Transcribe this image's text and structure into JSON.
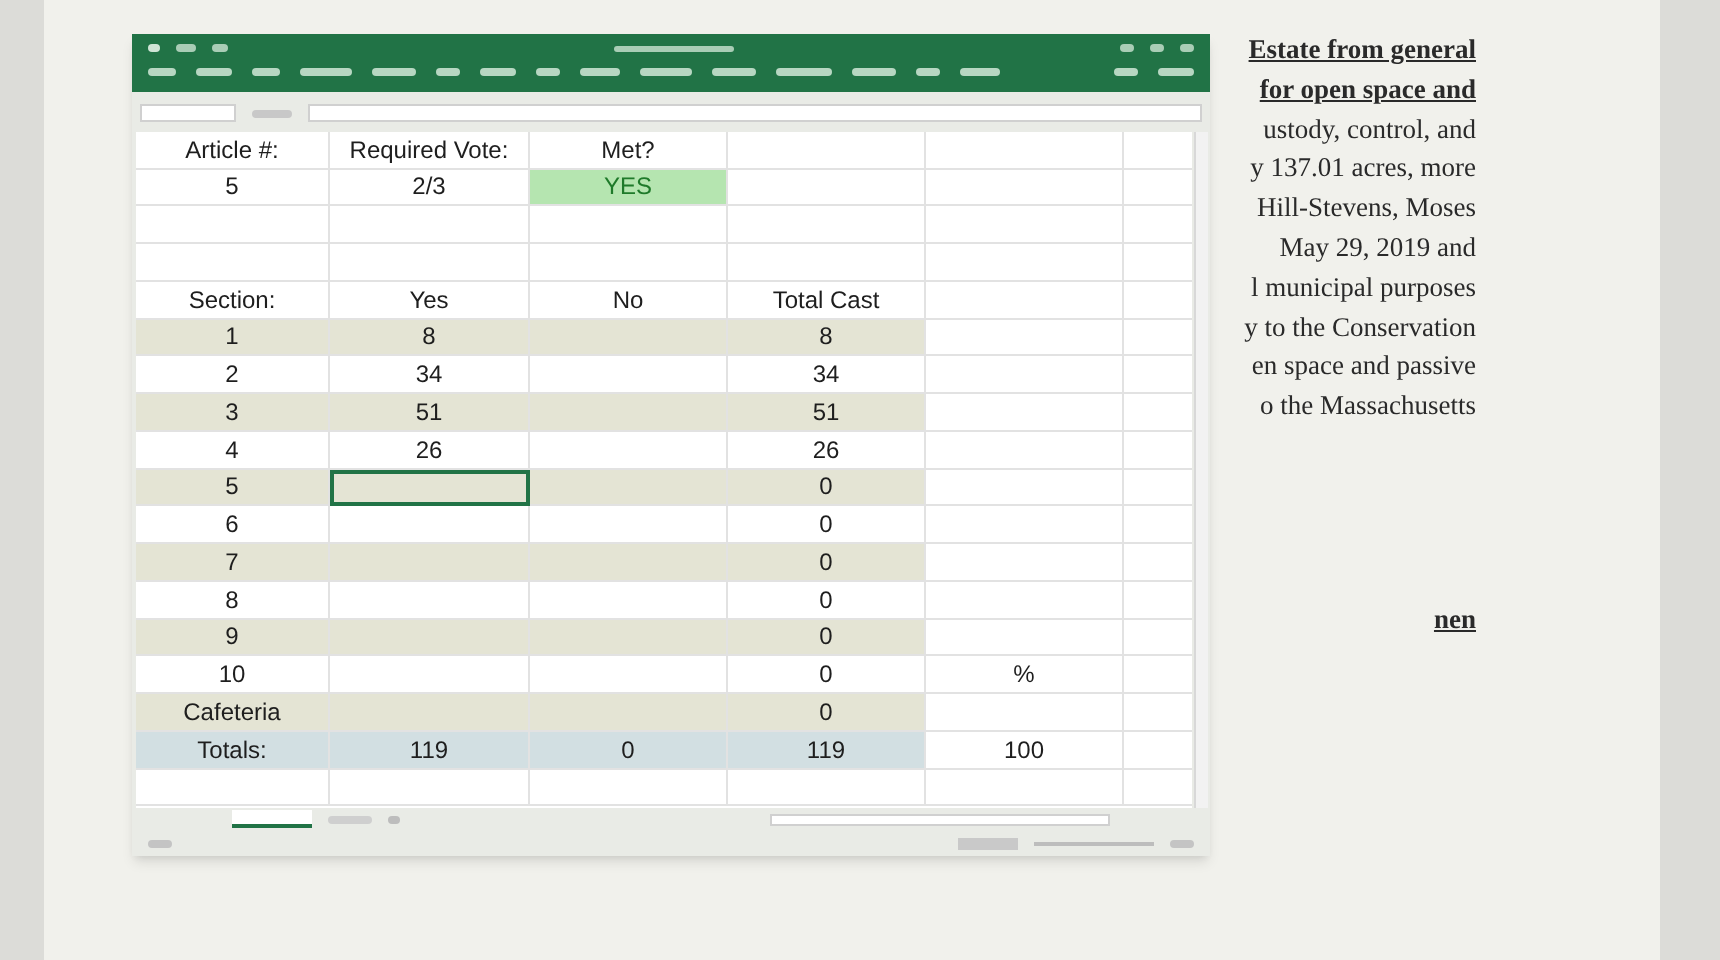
{
  "document": {
    "blocks": [
      {
        "bold": true,
        "lines": [
          "Estate from general",
          "for open space and"
        ]
      },
      {
        "bold": false,
        "lines": [
          "ustody, control, and",
          "y 137.01 acres, more",
          "Hill-Stevens, Moses",
          "May 29, 2019 and",
          "l municipal purposes",
          "y to the Conservation",
          "en space and passive",
          "o the Massachusetts"
        ]
      },
      {
        "bold": true,
        "lines": [
          "nen"
        ]
      }
    ]
  },
  "sheet": {
    "rows": [
      {
        "kind": "plain",
        "cells": [
          {
            "text": "Article #:",
            "selected": false
          },
          {
            "text": "Required Vote:",
            "selected": false
          },
          {
            "text": "Met?",
            "selected": false
          },
          {
            "selected": false
          },
          {
            "selected": false
          }
        ]
      },
      {
        "kind": "plain",
        "cells": [
          {
            "text": "5",
            "selected": false
          },
          {
            "text": "2/3",
            "selected": false
          },
          {
            "text": "YES",
            "highlight": true,
            "selected": false
          },
          {
            "selected": false
          },
          {
            "selected": false
          }
        ]
      },
      {
        "kind": "plain",
        "cells": [
          {
            "selected": false
          },
          {
            "selected": false
          },
          {
            "selected": false
          },
          {
            "selected": false
          },
          {
            "selected": false
          }
        ]
      },
      {
        "kind": "plain",
        "cells": [
          {
            "selected": false
          },
          {
            "selected": false
          },
          {
            "selected": false
          },
          {
            "selected": false
          },
          {
            "selected": false
          }
        ]
      },
      {
        "kind": "plain",
        "cells": [
          {
            "text": "Section:",
            "selected": false
          },
          {
            "text": "Yes",
            "selected": false
          },
          {
            "text": "No",
            "selected": false
          },
          {
            "text": "Total Cast",
            "selected": false
          },
          {
            "selected": false
          }
        ]
      },
      {
        "kind": "band",
        "cells": [
          {
            "text": "1",
            "selected": false
          },
          {
            "text": "8",
            "selected": false
          },
          {
            "selected": false
          },
          {
            "text": "8",
            "selected": false
          },
          {
            "selected": false
          }
        ]
      },
      {
        "kind": "plain",
        "cells": [
          {
            "text": "2",
            "selected": false
          },
          {
            "text": "34",
            "selected": false
          },
          {
            "selected": false
          },
          {
            "text": "34",
            "selected": false
          },
          {
            "selected": false
          }
        ]
      },
      {
        "kind": "band",
        "cells": [
          {
            "text": "3",
            "selected": false
          },
          {
            "text": "51",
            "selected": false
          },
          {
            "selected": false
          },
          {
            "text": "51",
            "selected": false
          },
          {
            "selected": false
          }
        ]
      },
      {
        "kind": "plain",
        "cells": [
          {
            "text": "4",
            "selected": false
          },
          {
            "text": "26",
            "selected": false
          },
          {
            "selected": false
          },
          {
            "text": "26",
            "selected": false
          },
          {
            "selected": false
          }
        ]
      },
      {
        "kind": "band",
        "cells": [
          {
            "text": "5",
            "selected": false
          },
          {
            "selected": true
          },
          {
            "selected": false
          },
          {
            "text": "0",
            "selected": false
          },
          {
            "selected": false
          }
        ]
      },
      {
        "kind": "plain",
        "cells": [
          {
            "text": "6",
            "selected": false
          },
          {
            "selected": false
          },
          {
            "selected": false
          },
          {
            "text": "0",
            "selected": false
          },
          {
            "selected": false
          }
        ]
      },
      {
        "kind": "band",
        "cells": [
          {
            "text": "7",
            "selected": false
          },
          {
            "selected": false
          },
          {
            "selected": false
          },
          {
            "text": "0",
            "selected": false
          },
          {
            "selected": false
          }
        ]
      },
      {
        "kind": "plain",
        "cells": [
          {
            "text": "8",
            "selected": false
          },
          {
            "selected": false
          },
          {
            "selected": false
          },
          {
            "text": "0",
            "selected": false
          },
          {
            "selected": false
          }
        ]
      },
      {
        "kind": "band",
        "cells": [
          {
            "text": "9",
            "selected": false
          },
          {
            "selected": false
          },
          {
            "selected": false
          },
          {
            "text": "0",
            "selected": false
          },
          {
            "selected": false
          }
        ]
      },
      {
        "kind": "plain",
        "cells": [
          {
            "text": "10",
            "selected": false
          },
          {
            "selected": false
          },
          {
            "selected": false
          },
          {
            "text": "0",
            "selected": false
          },
          {
            "text": "%",
            "selected": false
          }
        ]
      },
      {
        "kind": "band",
        "cells": [
          {
            "text": "Cafeteria",
            "selected": false
          },
          {
            "selected": false
          },
          {
            "selected": false
          },
          {
            "text": "0",
            "selected": false
          },
          {
            "selected": false
          }
        ]
      },
      {
        "kind": "total",
        "cells": [
          {
            "text": "Totals:",
            "selected": false
          },
          {
            "text": "119",
            "selected": false
          },
          {
            "text": "0",
            "selected": false
          },
          {
            "text": "119",
            "selected": false
          },
          {
            "text": "100",
            "selected": false
          }
        ]
      },
      {
        "kind": "plain",
        "cells": [
          {
            "selected": false
          },
          {
            "selected": false
          },
          {
            "selected": false
          },
          {
            "selected": false
          },
          {
            "selected": false
          }
        ]
      }
    ]
  }
}
